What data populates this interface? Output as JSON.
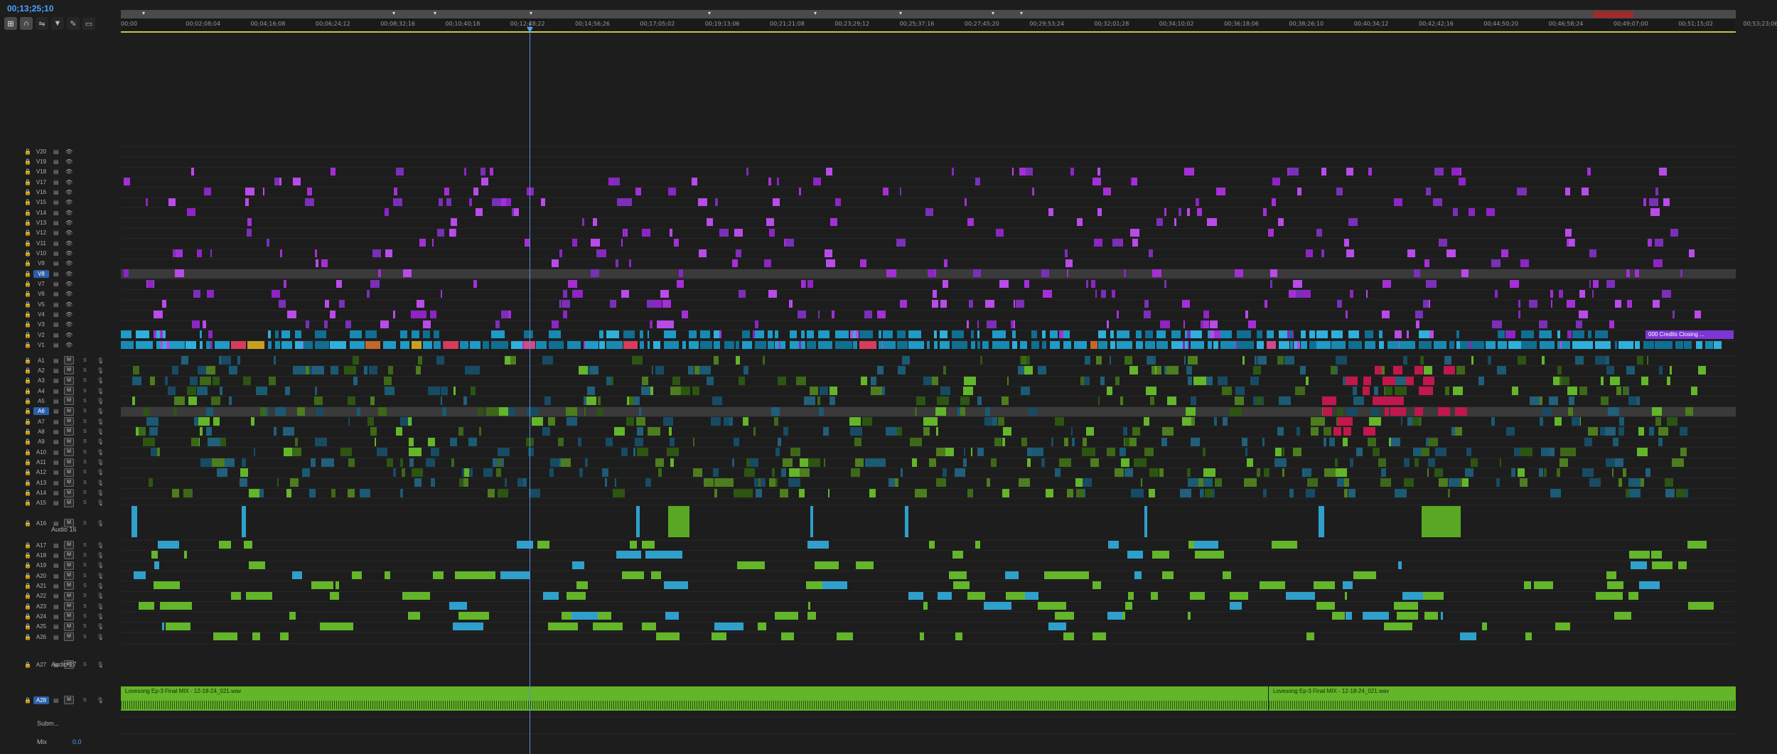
{
  "playhead_timecode": "00;13;25;10",
  "toolbar": {
    "tools": [
      {
        "name": "snap-icon",
        "glyph": "⊞",
        "active": true
      },
      {
        "name": "magnet-icon",
        "glyph": "∩",
        "active": true
      },
      {
        "name": "linked-selection-icon",
        "glyph": "⇋",
        "active": false
      },
      {
        "name": "add-marker-icon",
        "glyph": "▼",
        "active": false
      },
      {
        "name": "wrench-icon",
        "glyph": "✎",
        "active": false
      },
      {
        "name": "captions-icon",
        "glyph": "▭",
        "active": false
      }
    ]
  },
  "ruler": {
    "ticks": [
      "00;00",
      "00;02;08;04",
      "00;04;16;08",
      "00;06;24;12",
      "00;08;32;16",
      "00;10;40;18",
      "00;12;48;22",
      "00;14;56;26",
      "00;17;05;02",
      "00;19;13;06",
      "00;21;21;08",
      "00;23;29;12",
      "00;25;37;16",
      "00;27;45;20",
      "00;29;53;24",
      "00;32;01;28",
      "00;34;10;02",
      "00;36;18;06",
      "00;38;26;10",
      "00;40;34;12",
      "00;42;42;16",
      "00;44;50;20",
      "00;46;58;24",
      "00;49;07;00",
      "00;51;15;02",
      "00;53;23;06"
    ]
  },
  "video_tracks": [
    "V20",
    "V19",
    "V18",
    "V17",
    "V16",
    "V15",
    "V14",
    "V13",
    "V12",
    "V11",
    "V10",
    "V9",
    "V8",
    "V7",
    "V6",
    "V5",
    "V4",
    "V3",
    "V2",
    "V1"
  ],
  "audio_tracks_a": [
    "A1",
    "A2",
    "A3",
    "A4",
    "A5",
    "A6",
    "A7",
    "A8",
    "A9",
    "A10",
    "A11",
    "A12",
    "A13",
    "A14",
    "A15"
  ],
  "audio16": {
    "track": "A16",
    "name": "Audio 16",
    "m": "M",
    "s": "S"
  },
  "audio_tracks_b": [
    "A17",
    "A18",
    "A19",
    "A20",
    "A21",
    "A22",
    "A23",
    "A24",
    "A25",
    "A26"
  ],
  "audio27": {
    "track": "A27",
    "name": "Audio 27",
    "m": "M",
    "s": "S"
  },
  "a28": {
    "track": "A28",
    "m": "M",
    "s": "S"
  },
  "submix": {
    "label": "Subm...",
    "m": "M",
    "s": "S"
  },
  "mix": {
    "label": "Mix",
    "value": "0.0"
  },
  "selected_video_track": "V8",
  "selected_audio_track": "A6",
  "header_buttons": {
    "m": "M",
    "s": "S"
  },
  "mix_clips": [
    {
      "name": "Lovesong Ep-3 Final MIX - 12-18-24_021.wav"
    },
    {
      "name": "Lovesong Ep-3 Final MIX - 12-18-24_021.wav"
    }
  ],
  "credits_clip": "000 Credits Closing ...",
  "colors": {
    "accent": "#4aa3ff",
    "audio_green": "#63b52a",
    "video_teal": "#1e9bc8",
    "video_purple": "#a52fd6",
    "solo_yellow": "#d8b41d",
    "marker_red": "#a22a2a"
  }
}
